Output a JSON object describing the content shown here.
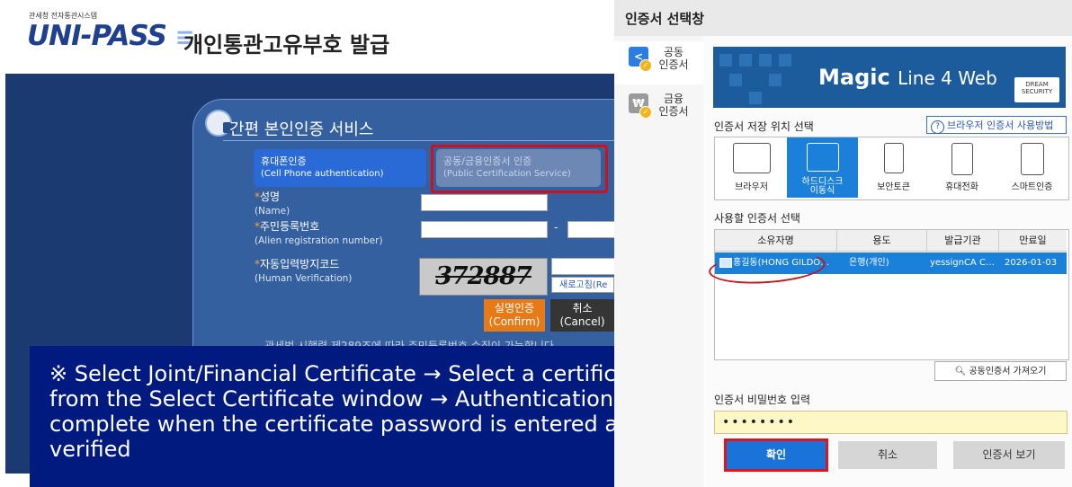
{
  "left_page": {
    "agency": "관세청 전자통관시스템",
    "logo_text": "UNI-PASS",
    "title": "개인통관고유부호 발급",
    "panel_title": "간편 본인인증 서비스",
    "option_phone": {
      "ko": "휴대폰인증",
      "en": "(Cell Phone authentication)"
    },
    "option_cert": {
      "ko": "공동/금융인증서 인증",
      "en": "(Public Certification Service)"
    },
    "name_label": {
      "ko": "성명",
      "en": "(Name)"
    },
    "reg_label": {
      "ko": "주민등록번호",
      "en": "(Alien registration number)"
    },
    "reg_dash": "-",
    "captcha_label": {
      "ko": "자동입력방지코드",
      "en": "(Human Verification)"
    },
    "captcha_text": "372887",
    "refresh_label": "새로고침(Re",
    "confirm_button": {
      "ko": "실명인증",
      "en": "(Confirm)"
    },
    "cancel_button": {
      "ko": "취소",
      "en": "(Cancel)"
    },
    "note": "- 관세법 시행령 제289조에 따라 주민등록번호 수집이 가능합니다"
  },
  "caption": "※ Select Joint/Financial Certificate → Select a certificate from the Select Certificate window → Authentication is complete when the certificate password is entered and verified",
  "dialog": {
    "title": "인증서 선택창",
    "side_items": [
      {
        "label": "공동\n인증서",
        "icon": "<"
      },
      {
        "label": "금융\n인증서",
        "icon": "₩"
      }
    ],
    "banner": {
      "brand": "Magic",
      "brand_rest": "Line 4 Web",
      "logo": "DREAM SECURITY"
    },
    "storage_label": "인증서 저장 위치 선택",
    "help_label": "브라우저 인증서 사용방법",
    "storage_items": [
      {
        "label": "브라우저"
      },
      {
        "label": "하드디스크\n이동식"
      },
      {
        "label": "보안토큰"
      },
      {
        "label": "휴대전화"
      },
      {
        "label": "스마트인증"
      }
    ],
    "cert_select_label": "사용할 인증서 선택",
    "table_headers": [
      "소유자명",
      "용도",
      "발급기관",
      "만료일"
    ],
    "table_row": {
      "owner": "홍길동(HONG GILDO…",
      "usage": "은행(개인)",
      "issuer": "yessignCA C…",
      "expiry": "2026-01-03"
    },
    "import_button": "공동인증서 가져오기",
    "password_label": "인증서 비밀번호 입력",
    "password_value": "••••••••",
    "ok_button": "확인",
    "cancel_button": "취소",
    "view_button": "인증서 보기"
  },
  "colors": {
    "accent": "#1a80d9",
    "highlight_red": "#e1141b",
    "caption_bg": "#001a7f",
    "page_bg": "#1c3a72"
  }
}
